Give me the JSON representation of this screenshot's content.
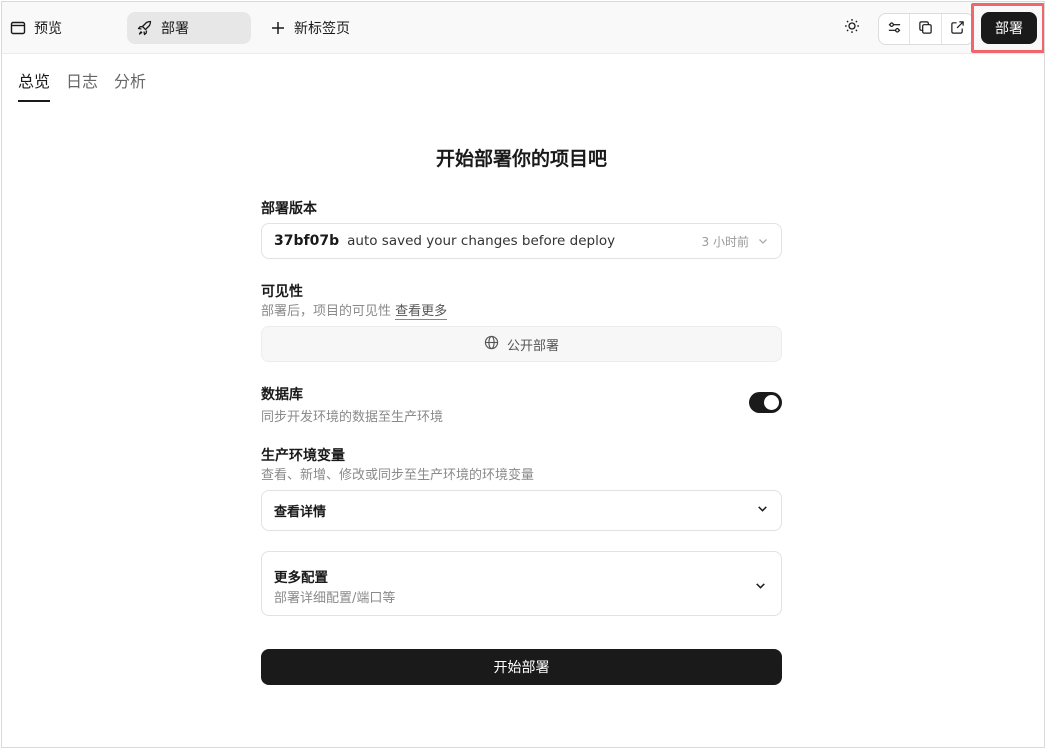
{
  "topbar": {
    "tab_preview": "预览",
    "tab_deploy": "部署",
    "tab_new": "新标签页",
    "deploy_button": "部署"
  },
  "subtabs": [
    "总览",
    "日志",
    "分析"
  ],
  "form": {
    "heading": "开始部署你的项目吧",
    "version_label": "部署版本",
    "version_hash": "37bf07b",
    "version_message": "auto saved your changes before deploy",
    "version_time": "3 小时前",
    "visibility_label": "可见性",
    "visibility_desc": "部署后，项目的可见性",
    "visibility_link": "查看更多",
    "public_button": "公开部署",
    "database_label": "数据库",
    "database_desc": "同步开发环境的数据至生产环境",
    "database_sync": true,
    "env_label": "生产环境变量",
    "env_desc": "查看、新增、修改或同步至生产环境的环境变量",
    "env_select": "查看详情",
    "more_title": "更多配置",
    "more_desc": "部署详细配置/端口等",
    "start_button": "开始部署"
  },
  "icons": {
    "preview": "window-icon",
    "deploy": "rocket-icon",
    "new": "plus-icon",
    "theme": "sun-icon",
    "settings": "sliders-icon",
    "copy": "copy-icon",
    "open": "external-link-icon",
    "globe": "globe-icon",
    "chevron": "chevron-down-icon"
  }
}
